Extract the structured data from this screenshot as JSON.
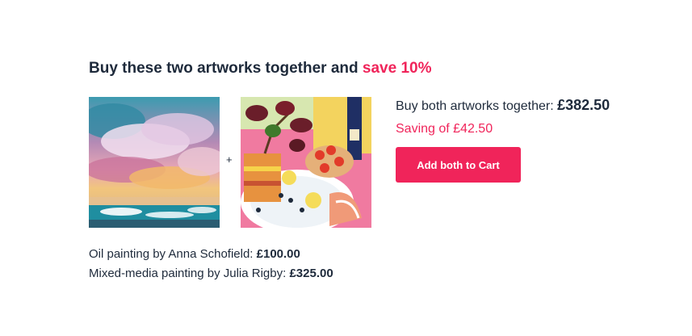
{
  "heading": {
    "text": "Buy these two artworks together and ",
    "accent": "save 10%"
  },
  "artworks": [
    {
      "image": "abstract-seascape-sunset",
      "label": "Oil painting by Anna Schofield: ",
      "price": "£100.00"
    },
    {
      "image": "table-still-life-with-plant-tomatoes-wine",
      "label": "Mixed-media painting by Julia Rigby: ",
      "price": "£325.00"
    }
  ],
  "plus": "+",
  "bundle": {
    "label": "Buy both artworks together: ",
    "price": "£382.50",
    "saving": "Saving of £42.50",
    "button": "Add both to Cart"
  },
  "colors": {
    "accent": "#f0245a",
    "text": "#1e2a3b"
  }
}
